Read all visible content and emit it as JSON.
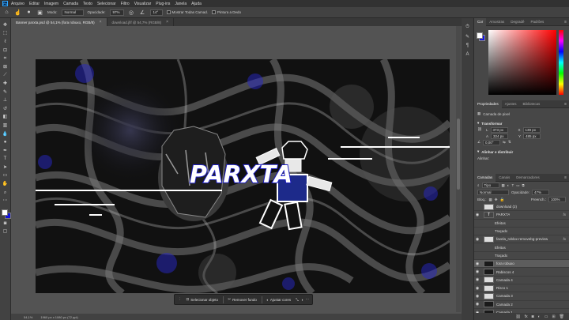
{
  "menubar": {
    "items": [
      "Arquivo",
      "Editar",
      "Imagem",
      "Camada",
      "Texto",
      "Selecionar",
      "Filtro",
      "Visualizar",
      "Plug-ins",
      "Janela",
      "Ajuda"
    ]
  },
  "options": {
    "mode_label": "Modo:",
    "mode_value": "Normal",
    "opacity_label": "Opacidade:",
    "opacity_value": "97%",
    "flow_value": "14°",
    "sample_all": "Mostrar Todas Camad.",
    "align_label": "Pintura a Dedo"
  },
  "tabs": [
    {
      "label": "Banner parxta.psd @ 54,1% (fora robuxo, RGB/8)",
      "close": "×"
    },
    {
      "label": "download.jfif @ 54,7% (RGB/8)",
      "close": "×"
    }
  ],
  "canvas": {
    "title_text": "PARXTA"
  },
  "context_bar": {
    "select_subject": "Selecionar objeto",
    "remove_bg": "Remover fundo",
    "adjust": "Ajustar cores"
  },
  "status": {
    "zoom": "54,1%",
    "size": "1960 px x 1080 px (72 ppi)"
  },
  "color_panel": {
    "tabs": [
      "Cor",
      "Amostras",
      "Degradê",
      "Padrões"
    ]
  },
  "properties": {
    "tabs": [
      "Propriedades",
      "Ajustes",
      "Bibliotecas"
    ],
    "layer_type": "Camada de pixel",
    "transform": "Transformar",
    "w_label": "L",
    "w_value": "373 px",
    "h_label": "A",
    "h_value": "324 px",
    "x_label": "X",
    "x_value": "139 px",
    "y_label": "Y",
    "y_value": "485 px",
    "angle": "0,00°",
    "align_section": "Alinhar e distribuir",
    "align_sub": "Alinhar:"
  },
  "layers": {
    "tabs": [
      "Camadas",
      "Canais",
      "Demarcadores"
    ],
    "filter": "Tipo",
    "blend": "Normal",
    "opacity_label": "Opacidade:",
    "opacity_value": "47%",
    "lock_label": "Bloq.:",
    "fill_label": "Preench.:",
    "fill_value": "100%",
    "rows": [
      {
        "name": "download (2)",
        "visible": "",
        "fx": "",
        "kind": "white",
        "sub": false,
        "selected": false
      },
      {
        "name": "PARXTA",
        "visible": "◉",
        "fx": "fx",
        "kind": "text",
        "sub": false,
        "selected": false
      },
      {
        "name": "Efeitos",
        "visible": "",
        "fx": "",
        "kind": "none",
        "sub": true,
        "selected": false
      },
      {
        "name": "Traçado",
        "visible": "",
        "fx": "",
        "kind": "none",
        "sub": true,
        "selected": false
      },
      {
        "name": "favela_roblox-removebg-preview",
        "visible": "◉",
        "fx": "fx",
        "kind": "white",
        "sub": false,
        "selected": false
      },
      {
        "name": "Efeitos",
        "visible": "",
        "fx": "",
        "kind": "none",
        "sub": true,
        "selected": false
      },
      {
        "name": "Traçado",
        "visible": "",
        "fx": "",
        "kind": "none",
        "sub": true,
        "selected": false
      },
      {
        "name": "fora robuxo",
        "visible": "◉",
        "fx": "",
        "kind": "dark",
        "sub": false,
        "selected": true
      },
      {
        "name": "Rabiscos 4",
        "visible": "◉",
        "fx": "",
        "kind": "dark",
        "sub": false,
        "selected": false
      },
      {
        "name": "Camada 4",
        "visible": "◉",
        "fx": "",
        "kind": "white",
        "sub": false,
        "selected": false
      },
      {
        "name": "Risco 1",
        "visible": "◉",
        "fx": "",
        "kind": "white",
        "sub": false,
        "selected": false
      },
      {
        "name": "Camada 3",
        "visible": "◉",
        "fx": "",
        "kind": "white",
        "sub": false,
        "selected": false
      },
      {
        "name": "Camada 2",
        "visible": "◉",
        "fx": "",
        "kind": "dark",
        "sub": false,
        "selected": false
      },
      {
        "name": "Camada 1",
        "visible": "◉",
        "fx": "",
        "kind": "dark",
        "sub": false,
        "selected": false
      }
    ]
  },
  "colors": {
    "foreground": "#ffffff",
    "background": "#1111d6",
    "accent": "#31a8ff"
  }
}
